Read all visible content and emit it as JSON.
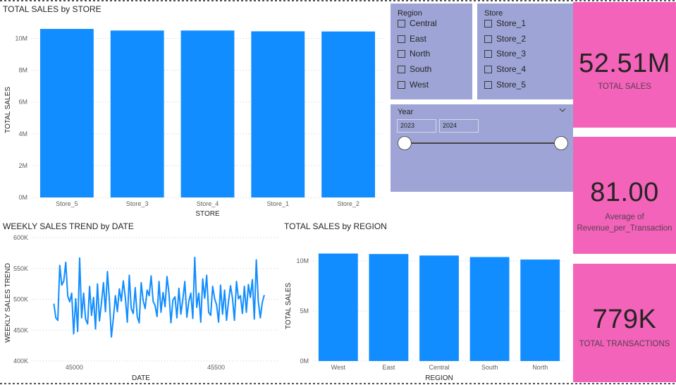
{
  "store_chart": {
    "title": "TOTAL SALES by STORE",
    "chart_data": {
      "type": "bar",
      "title": "TOTAL SALES by STORE",
      "xlabel": "STORE",
      "ylabel": "TOTAL SALES",
      "categories": [
        "Store_5",
        "Store_3",
        "Store_4",
        "Store_1",
        "Store_2"
      ],
      "values": [
        10.6,
        10.5,
        10.5,
        10.45,
        10.44
      ],
      "value_unit": "M",
      "ylim": [
        0,
        11
      ],
      "yticks": [
        "0M",
        "2M",
        "4M",
        "6M",
        "8M",
        "10M"
      ],
      "grid": true,
      "color": "#118DFF"
    }
  },
  "trend_chart": {
    "title": "WEEKLY SALES TREND by DATE",
    "chart_data": {
      "type": "line",
      "title": "WEEKLY SALES TREND by DATE",
      "xlabel": "DATE",
      "ylabel": "WEEKLY SALES TREND",
      "xlim": [
        44850,
        45720
      ],
      "ylim": [
        400,
        600
      ],
      "xticks": [
        "45000",
        "45500"
      ],
      "yticks": [
        "400K",
        "450K",
        "500K",
        "550K",
        "600K"
      ],
      "grid": true,
      "color": "#118DFF",
      "x": [
        44928,
        44935,
        44942,
        44949,
        44956,
        44963,
        44970,
        44977,
        44984,
        44991,
        44998,
        45005,
        45012,
        45019,
        45026,
        45033,
        45040,
        45047,
        45054,
        45061,
        45068,
        45075,
        45082,
        45089,
        45096,
        45103,
        45110,
        45117,
        45124,
        45131,
        45138,
        45145,
        45152,
        45159,
        45166,
        45173,
        45180,
        45187,
        45194,
        45201,
        45208,
        45215,
        45222,
        45229,
        45236,
        45243,
        45250,
        45257,
        45264,
        45271,
        45278,
        45285,
        45292,
        45299,
        45306,
        45313,
        45320,
        45327,
        45334,
        45341,
        45348,
        45355,
        45362,
        45369,
        45376,
        45383,
        45390,
        45397,
        45404,
        45411,
        45418,
        45425,
        45432,
        45439,
        45446,
        45453,
        45460,
        45467,
        45474,
        45481,
        45488,
        45495,
        45502,
        45509,
        45516,
        45523,
        45530,
        45537,
        45544,
        45551,
        45558,
        45565,
        45572,
        45579,
        45586,
        45593,
        45600,
        45607,
        45614,
        45621,
        45628,
        45635,
        45642,
        45649,
        45656,
        45663,
        45670
      ],
      "y": [
        493,
        470,
        466,
        555,
        523,
        530,
        560,
        505,
        496,
        510,
        444,
        501,
        448,
        567,
        470,
        510,
        468,
        460,
        521,
        474,
        503,
        452,
        525,
        465,
        495,
        527,
        480,
        545,
        499,
        439,
        470,
        506,
        480,
        517,
        497,
        530,
        503,
        463,
        539,
        485,
        477,
        519,
        472,
        462,
        527,
        498,
        485,
        515,
        506,
        538,
        497,
        490,
        472,
        529,
        479,
        511,
        488,
        537,
        510,
        462,
        499,
        504,
        470,
        518,
        476,
        500,
        529,
        471,
        497,
        510,
        469,
        568,
        487,
        510,
        463,
        533,
        502,
        539,
        479,
        474,
        521,
        501,
        491,
        463,
        523,
        476,
        515,
        466,
        497,
        522,
        502,
        466,
        529,
        501,
        506,
        477,
        521,
        479,
        524,
        503,
        532,
        468,
        564,
        497,
        470,
        495,
        507,
        507
      ]
    }
  },
  "region_chart": {
    "title": "TOTAL SALES by REGION",
    "chart_data": {
      "type": "bar",
      "title": "TOTAL SALES by REGION",
      "xlabel": "REGION",
      "ylabel": "TOTAL SALES",
      "categories": [
        "West",
        "East",
        "Central",
        "South",
        "North"
      ],
      "values": [
        10.75,
        10.7,
        10.55,
        10.4,
        10.15
      ],
      "value_unit": "M",
      "ylim": [
        0,
        11
      ],
      "yticks": [
        "0M",
        "5M",
        "10M"
      ],
      "grid": true,
      "color": "#118DFF"
    }
  },
  "region_slicer": {
    "title": "Region",
    "items": [
      {
        "label": "Central"
      },
      {
        "label": "East"
      },
      {
        "label": "North"
      },
      {
        "label": "South"
      },
      {
        "label": "West"
      }
    ]
  },
  "store_slicer": {
    "title": "Store",
    "items": [
      {
        "label": "Store_1"
      },
      {
        "label": "Store_2"
      },
      {
        "label": "Store_3"
      },
      {
        "label": "Store_4"
      },
      {
        "label": "Store_5"
      }
    ]
  },
  "year_slicer": {
    "title": "Year",
    "start": "2023",
    "end": "2024",
    "chevron": "chevron-down-icon",
    "range_fraction": [
      0,
      1
    ]
  },
  "cards": [
    {
      "value": "52.51M",
      "label": "TOTAL SALES"
    },
    {
      "value": "81.00",
      "label": "Average of Revenue_per_Transaction"
    },
    {
      "value": "779K",
      "label": "TOTAL TRANSACTIONS"
    }
  ],
  "colors": {
    "accent": "#118DFF",
    "slicer_bg": "#9EA5D6",
    "card_bg": "#F263B9"
  }
}
